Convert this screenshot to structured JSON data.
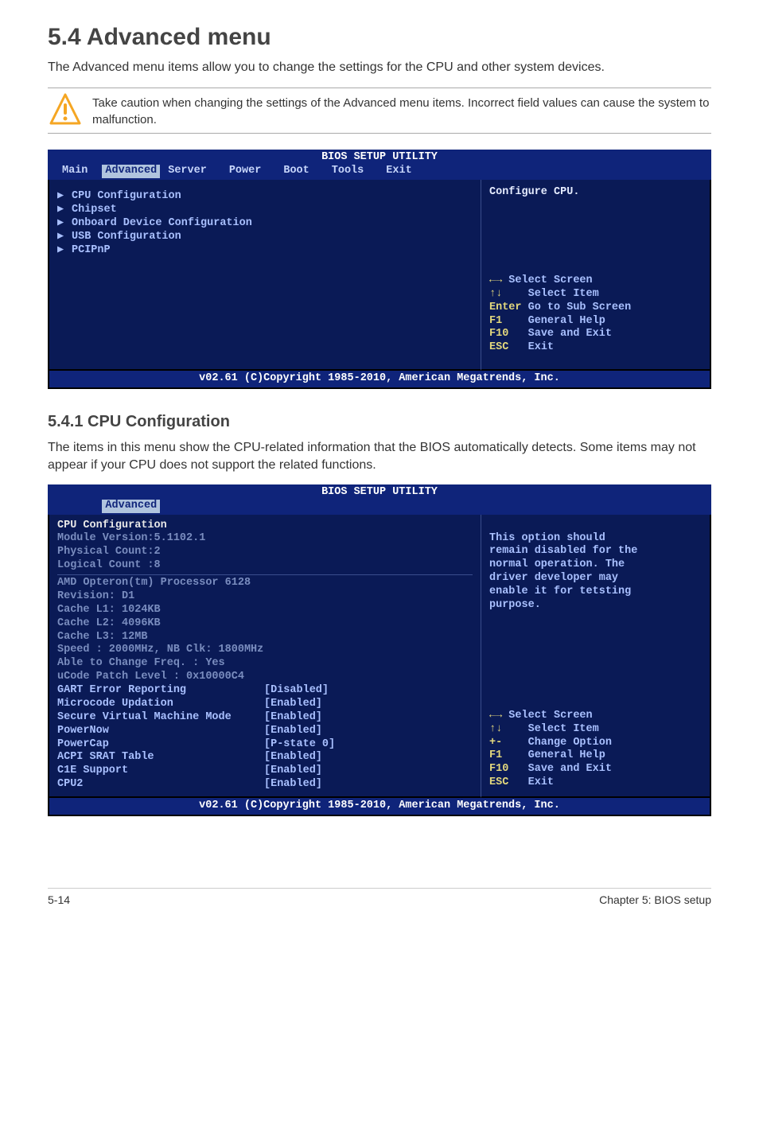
{
  "section": {
    "heading": "5.4    Advanced menu",
    "intro": "The Advanced menu items allow you to change the settings for the CPU and other system devices.",
    "caution": "Take caution when changing the settings of the Advanced menu items. Incorrect field values can cause the system to malfunction."
  },
  "bios1": {
    "title": "BIOS SETUP UTILITY",
    "tabs": [
      "Main",
      "Advanced",
      "Server",
      "Power",
      "Boot",
      "Tools",
      "Exit"
    ],
    "active_tab": "Advanced",
    "items": [
      "CPU Configuration",
      "Chipset",
      "Onboard Device Configuration",
      "USB Configuration",
      "PCIPnP"
    ],
    "help_top": "Configure CPU.",
    "help_keys": [
      {
        "k": "←→",
        "v": " Select Screen"
      },
      {
        "k": "↑↓",
        "v": "    Select Item"
      },
      {
        "k": "Enter",
        "v": " Go to Sub Screen"
      },
      {
        "k": "F1",
        "v": "    General Help"
      },
      {
        "k": "F10",
        "v": "   Save and Exit"
      },
      {
        "k": "ESC",
        "v": "   Exit"
      }
    ],
    "footer": "v02.61 (C)Copyright 1985-2010, American Megatrends, Inc."
  },
  "subsection": {
    "heading": "5.4.1      CPU Configuration",
    "text": "The items in this menu show the CPU-related information that the BIOS automatically detects. Some items may not appear if your CPU does not support the related functions."
  },
  "bios2": {
    "title": "BIOS SETUP UTILITY",
    "active_tab": "Advanced",
    "header_lines": [
      "CPU Configuration",
      "Module Version:5.1102.1",
      "Physical Count:2",
      "Logical Count :8"
    ],
    "grey_lines": [
      "AMD Opteron(tm) Processor 6128",
      "Revision: D1",
      "Cache L1: 1024KB",
      "Cache L2: 4096KB",
      "Cache L3: 12MB",
      "Speed   : 2000MHz,    NB Clk: 1800MHz",
      "Able to Change Freq.  : Yes",
      "uCode Patch Level     : 0x10000C4"
    ],
    "options": [
      {
        "label": "GART Error Reporting",
        "val": "[Disabled]"
      },
      {
        "label": "Microcode Updation",
        "val": "[Enabled]"
      },
      {
        "label": "Secure Virtual Machine Mode",
        "val": "[Enabled]"
      },
      {
        "label": "PowerNow",
        "val": "[Enabled]"
      },
      {
        "label": "PowerCap",
        "val": "[P-state 0]"
      },
      {
        "label": "ACPI SRAT Table",
        "val": "[Enabled]"
      },
      {
        "label": "C1E Support",
        "val": "[Enabled]"
      },
      {
        "label": "CPU2",
        "val": "[Enabled]"
      }
    ],
    "help_top": [
      "This option should",
      "remain disabled for the",
      "normal operation. The",
      "driver developer may",
      "enable it for tetsting",
      "purpose."
    ],
    "help_keys": [
      {
        "k": "←→",
        "v": " Select Screen"
      },
      {
        "k": "↑↓",
        "v": "    Select Item"
      },
      {
        "k": "+-",
        "v": "    Change Option"
      },
      {
        "k": "F1",
        "v": "    General Help"
      },
      {
        "k": "F10",
        "v": "   Save and Exit"
      },
      {
        "k": "ESC",
        "v": "   Exit"
      }
    ],
    "footer": "v02.61 (C)Copyright 1985-2010, American Megatrends, Inc."
  },
  "footer": {
    "left": "5-14",
    "right": "Chapter 5: BIOS setup"
  }
}
